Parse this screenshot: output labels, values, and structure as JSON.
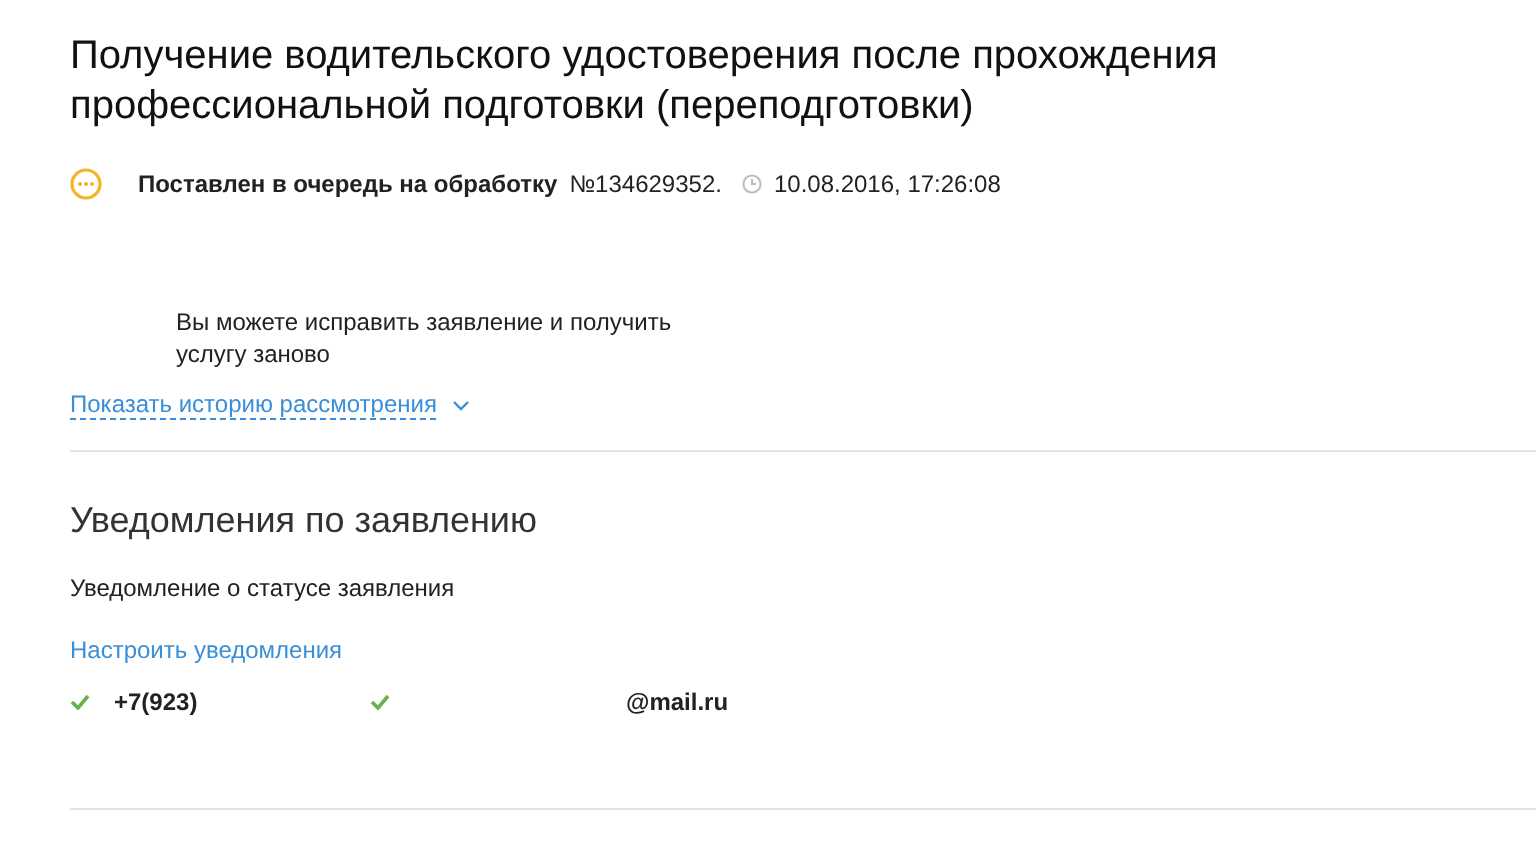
{
  "title": "Получение водительского удостоверения после прохождения профессиональной подготовки (переподготовки)",
  "status": {
    "label": "Поставлен в очередь на обработку",
    "number": "№134629352.",
    "datetime": "10.08.2016, 17:26:08"
  },
  "message": "Вы можете исправить заявление и получить услугу заново",
  "history_link": "Показать историю рассмотрения",
  "notifications": {
    "heading": "Уведомления по заявлению",
    "subtitle": "Уведомление о статусе заявления",
    "settings_link": "Настроить уведомления",
    "contacts": [
      {
        "value": "+7(923)",
        "confirmed": true
      },
      {
        "value": "@mail.ru",
        "confirmed": true
      }
    ]
  }
}
